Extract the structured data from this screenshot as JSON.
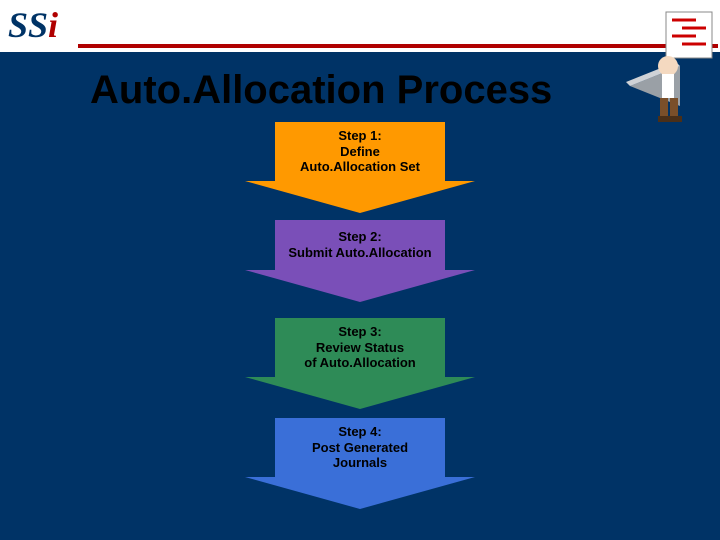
{
  "logo": {
    "text_main": "SS",
    "text_accent": "i"
  },
  "title": "Auto.Allocation Process",
  "steps": [
    {
      "label": "Step 1:\nDefine\nAuto.Allocation Set"
    },
    {
      "label": "Step 2:\nSubmit Auto.Allocation"
    },
    {
      "label": "Step 3:\nReview Status\nof Auto.Allocation"
    },
    {
      "label": "Step 4:\nPost Generated\nJournals"
    }
  ]
}
